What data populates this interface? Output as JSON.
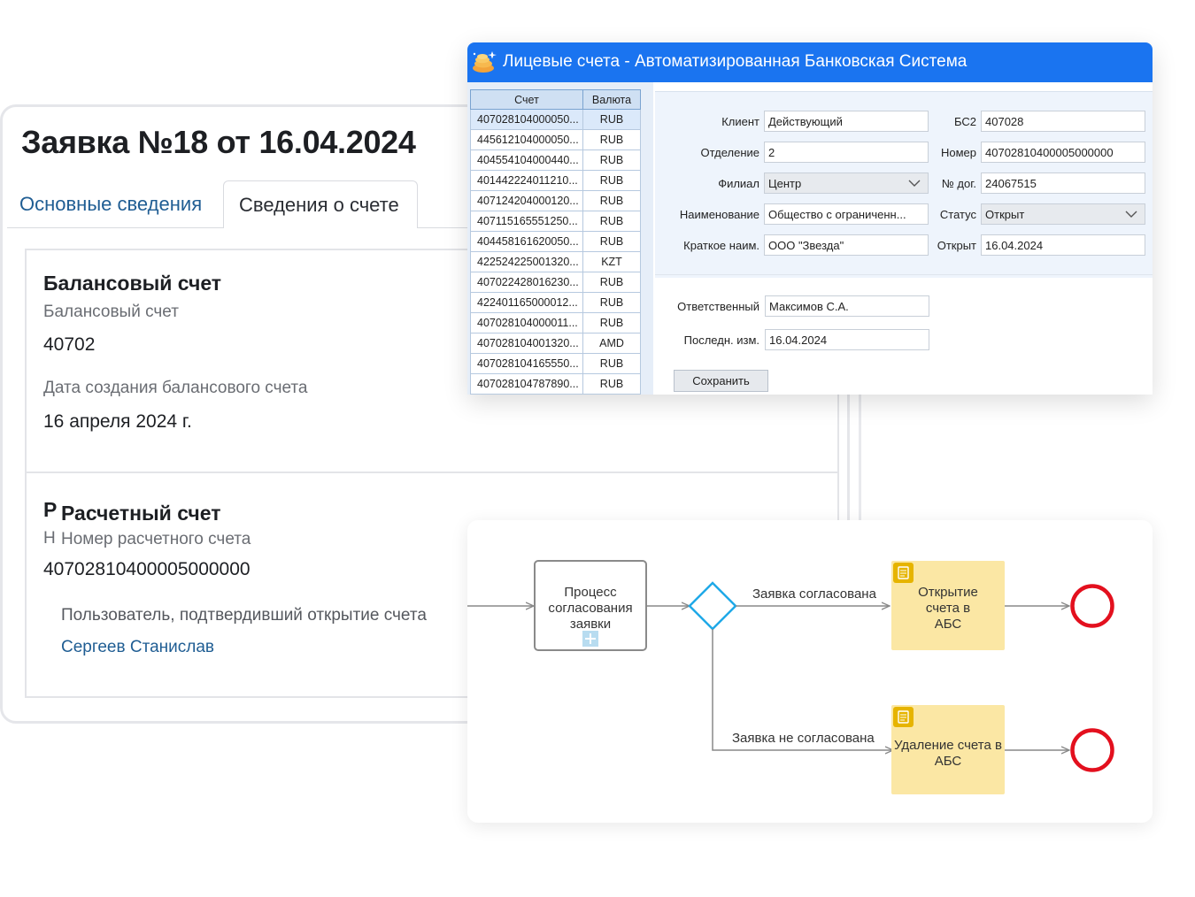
{
  "request": {
    "title": "Заявка №18 от 16.04.2024",
    "tabs": [
      {
        "label": "Основные сведения",
        "active": false
      },
      {
        "label": "Сведения о счете",
        "active": true
      }
    ],
    "balance_section": {
      "heading": "Балансовый счет",
      "field_label": "Балансовый счет",
      "field_value": "40702",
      "date_label": "Дата создания балансового счета",
      "date_value": "16 апреля 2024 г."
    },
    "settlement_section": {
      "heading_clipped": "Р",
      "heading": "Расчетный счет",
      "field_label_clipped": "Н",
      "field_label": "Номер расчетного  счета",
      "field_value": "40702810400005000000",
      "confirm_label": "Пользователь, подтвердивший открытие счета",
      "confirm_user": "Сергеев Станислав"
    }
  },
  "abs_window": {
    "title": "Лицевые счета - Автоматизированная Банковская Система",
    "accent": "#1a74f0",
    "table": {
      "headers": [
        "Счет",
        "Валюта"
      ],
      "rows": [
        [
          "407028104000050...",
          "RUB"
        ],
        [
          "445612104000050...",
          "RUB"
        ],
        [
          "404554104000440...",
          "RUB"
        ],
        [
          "401442224011210...",
          "RUB"
        ],
        [
          "407124204000120...",
          "RUB"
        ],
        [
          "407115165551250...",
          "RUB"
        ],
        [
          "404458161620050...",
          "RUB"
        ],
        [
          "422524225001320...",
          "KZT"
        ],
        [
          "407022428016230...",
          "RUB"
        ],
        [
          "422401165000012...",
          "RUB"
        ],
        [
          "407028104000011...",
          "RUB"
        ],
        [
          "407028104001320...",
          "AMD"
        ],
        [
          "407028104165550...",
          "RUB"
        ],
        [
          "407028104787890...",
          "RUB"
        ]
      ]
    },
    "form": {
      "client": {
        "label": "Клиент",
        "value": "Действующий"
      },
      "bs2": {
        "label": "БС2",
        "value": "407028"
      },
      "department": {
        "label": "Отделение",
        "value": "2"
      },
      "number": {
        "label": "Номер",
        "value": "40702810400005000000"
      },
      "branch": {
        "label": "Филиал",
        "value": "Центр"
      },
      "contract": {
        "label": "№ дог.",
        "value": "24067515"
      },
      "name": {
        "label": "Наименование",
        "value": "Общество с ограниченн..."
      },
      "status": {
        "label": "Статус",
        "value": "Открыт"
      },
      "short_name": {
        "label": "Краткое наим.",
        "value": "ООО \"Звезда\""
      },
      "opened": {
        "label": "Открыт",
        "value": "16.04.2024"
      },
      "responsible": {
        "label": "Ответственный",
        "value": "Максимов С.А."
      },
      "last_change": {
        "label": "Последн. изм.",
        "value": "16.04.2024"
      }
    },
    "save_label": "Сохранить"
  },
  "bpmn": {
    "task_approval": "Процесс согласования заявки",
    "flow_approved": "Заявка согласована",
    "flow_rejected": "Заявка не согласована",
    "task_open": "Открытие счета в АБС",
    "task_delete": "Удаление счета в АБС",
    "colors": {
      "gateway": "#1fa9e8",
      "task_fill": "#fbe7a4",
      "task_icon": "#e6b400",
      "end_event": "#e3101e"
    }
  }
}
